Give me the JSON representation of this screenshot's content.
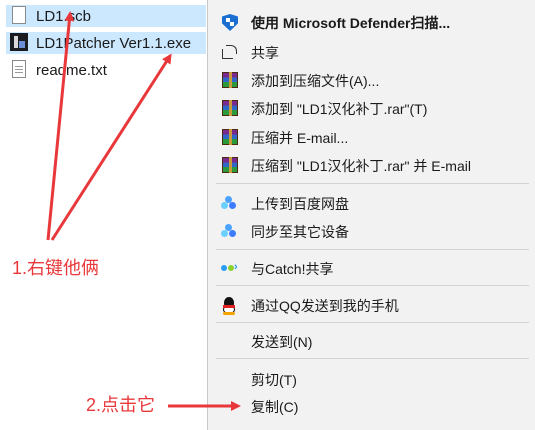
{
  "files": [
    {
      "name": "LD1.scb",
      "icon": "document-icon",
      "selected": true
    },
    {
      "name": "LD1Patcher Ver1.1.exe",
      "icon": "exe-app-icon",
      "selected": true
    },
    {
      "name": "readme.txt",
      "icon": "text-file-icon",
      "selected": false
    }
  ],
  "menu": {
    "defender": "使用 Microsoft Defender扫描...",
    "share": "共享",
    "add_archive": "添加到压缩文件(A)...",
    "add_rar": "添加到 \"LD1汉化补丁.rar\"(T)",
    "compress_email": "压缩并 E-mail...",
    "compress_rar_email": "压缩到 \"LD1汉化补丁.rar\" 并 E-mail",
    "upload_baidu": "上传到百度网盘",
    "sync_devices": "同步至其它设备",
    "catch_share": "与Catch!共享",
    "qq_send": "通过QQ发送到我的手机",
    "send_to": "发送到(N)",
    "cut": "剪切(T)",
    "copy": "复制(C)"
  },
  "annotations": {
    "step1": "1.右键他俩",
    "step2": "2.点击它",
    "color": "#e8383b"
  },
  "colors": {
    "selection": "#cce8ff",
    "menu_bg": "#f2f2f2",
    "defender_blue": "#1a6fd1"
  }
}
